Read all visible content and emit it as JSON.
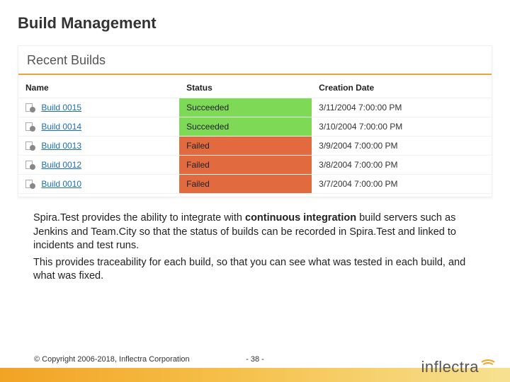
{
  "title": "Build Management",
  "panel": {
    "heading": "Recent Builds",
    "columns": {
      "name": "Name",
      "status": "Status",
      "date": "Creation Date"
    },
    "rows": [
      {
        "name": "Build 0015",
        "status": "Succeeded",
        "status_class": "succeeded",
        "date": "3/11/2004 7:00:00 PM"
      },
      {
        "name": "Build 0014",
        "status": "Succeeded",
        "status_class": "succeeded",
        "date": "3/10/2004 7:00:00 PM"
      },
      {
        "name": "Build 0013",
        "status": "Failed",
        "status_class": "failed",
        "date": "3/9/2004 7:00:00 PM"
      },
      {
        "name": "Build 0012",
        "status": "Failed",
        "status_class": "failed",
        "date": "3/8/2004 7:00:00 PM"
      },
      {
        "name": "Build 0010",
        "status": "Failed",
        "status_class": "failed",
        "date": "3/7/2004 7:00:00 PM"
      }
    ]
  },
  "body": {
    "p1a": "Spira.Test provides the ability to integrate with ",
    "p1b": "continuous integration",
    "p1c": " build servers such as Jenkins and Team.City so that the status of builds can be recorded in Spira.Test and linked to incidents and test runs.",
    "p2": "This provides traceability for each build, so that you can see what was tested in each build, and what was fixed."
  },
  "footer": {
    "copyright": "© Copyright 2006-2018, Inflectra Corporation",
    "page": "- 38 -",
    "logo_text": "inflectra"
  }
}
